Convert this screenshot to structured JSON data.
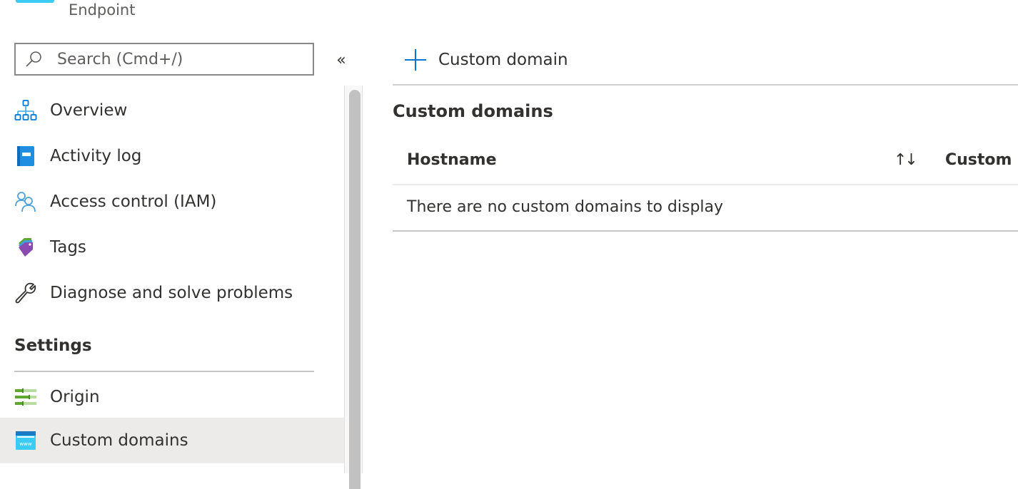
{
  "header": {
    "subtitle": "Endpoint",
    "resource_icon_color": "#3ccbf4"
  },
  "sidebar": {
    "search": {
      "placeholder": "Search (Cmd+/)",
      "value": ""
    },
    "collapse_icon": "«",
    "items": [
      {
        "label": "Overview",
        "icon": "overview-icon"
      },
      {
        "label": "Activity log",
        "icon": "activity-log-icon"
      },
      {
        "label": "Access control (IAM)",
        "icon": "access-control-icon"
      },
      {
        "label": "Tags",
        "icon": "tags-icon"
      },
      {
        "label": "Diagnose and solve problems",
        "icon": "wrench-icon"
      }
    ],
    "sections": [
      {
        "title": "Settings",
        "items": [
          {
            "label": "Origin",
            "icon": "origin-icon",
            "active": false
          },
          {
            "label": "Custom domains",
            "icon": "www-icon",
            "active": true
          }
        ]
      }
    ]
  },
  "main": {
    "toolbar": {
      "add_label": "Custom domain"
    },
    "heading": "Custom domains",
    "table": {
      "columns": [
        "Hostname",
        "Custom HTTPS"
      ],
      "visible_column_labels": [
        "Hostname",
        "Custom I"
      ],
      "sort_icon": "↑↓",
      "empty_message": "There are no custom domains to display",
      "rows": []
    }
  },
  "colors": {
    "accent": "#0078d4",
    "active_item_bg": "#edebe9",
    "text": "#323130"
  }
}
